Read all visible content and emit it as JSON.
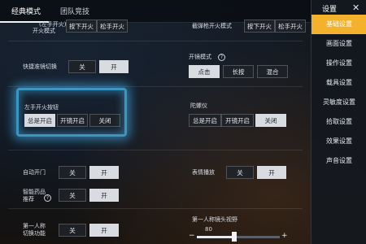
{
  "tabs": [
    {
      "label": "经典模式",
      "active": true
    },
    {
      "label": "团队竞技",
      "active": false
    }
  ],
  "rows": {
    "fire_mode": {
      "label": "开火模式",
      "sub": "(左手开火)",
      "options": [
        "按下开火",
        "松手开火"
      ]
    },
    "scope_fire_mode": {
      "label": "截弹枪开火模式",
      "options": [
        "按下开火",
        "松手开火"
      ]
    },
    "quick_switch": {
      "label": "快捷准镜切换",
      "off": "关",
      "on": "开"
    },
    "scope_mode": {
      "label": "开镜模式",
      "options": [
        "点击",
        "长按",
        "混合"
      ]
    },
    "left_fire_button": {
      "label": "左手开火按钮",
      "options": [
        "总是开启",
        "开镜开启",
        "关闭"
      ]
    },
    "gyroscope": {
      "label": "陀螺仪",
      "options": [
        "总是开启",
        "开镜开启",
        "关闭"
      ]
    },
    "auto_open_door": {
      "label": "自动开门",
      "off": "关",
      "on": "开"
    },
    "emoji_play": {
      "label": "表情播放",
      "off": "关",
      "on": "开"
    },
    "smart_medicine": {
      "label_line1": "智能药品",
      "label_line2": "推荐",
      "off": "关",
      "on": "开"
    },
    "fpp_switch": {
      "label_line1": "第一人称",
      "label_line2": "切换功能",
      "off": "关",
      "on": "开"
    },
    "fpp_fov": {
      "label": "第一人称镜头视野",
      "value": "80",
      "minus": "−",
      "plus": "+",
      "level_fraction": 0.45
    }
  },
  "sidebar": {
    "title": "设置",
    "items": [
      {
        "label": "基础设置",
        "active": true
      },
      {
        "label": "画面设置",
        "active": false
      },
      {
        "label": "操作设置",
        "active": false
      },
      {
        "label": "载具设置",
        "active": false
      },
      {
        "label": "灵敏度设置",
        "active": false
      },
      {
        "label": "拾取设置",
        "active": false
      },
      {
        "label": "效果设置",
        "active": false
      },
      {
        "label": "声音设置",
        "active": false
      }
    ]
  },
  "icons": {
    "help": "?",
    "close": "✕"
  }
}
